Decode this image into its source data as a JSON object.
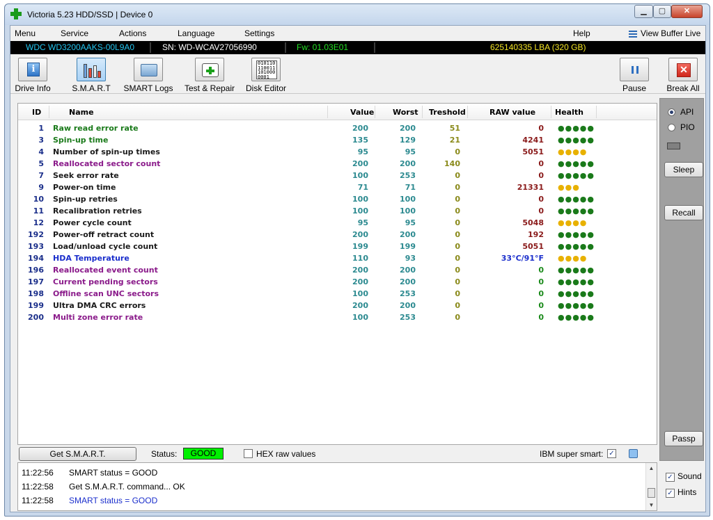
{
  "window": {
    "title": "Victoria 5.23 HDD/SSD | Device 0"
  },
  "menu": {
    "items": [
      "Menu",
      "Service",
      "Actions",
      "Language",
      "Settings",
      "Help"
    ],
    "view_buffer": "View Buffer Live"
  },
  "device": {
    "model": "WDC WD3200AAKS-00L9A0",
    "serial": "SN: WD-WCAV27056990",
    "firmware": "Fw: 01.03E01",
    "capacity": "625140335 LBA (320 GB)"
  },
  "toolbar": {
    "drive_info": "Drive Info",
    "smart": "S.M.A.R.T",
    "smart_logs": "SMART Logs",
    "test_repair": "Test & Repair",
    "disk_editor": "Disk Editor",
    "pause": "Pause",
    "break_all": "Break All",
    "hex_icon_text": "010110\n110011\n101000\n0001"
  },
  "table": {
    "headers": {
      "id": "ID",
      "name": "Name",
      "value": "Value",
      "worst": "Worst",
      "treshold": "Treshold",
      "raw": "RAW value",
      "health": "Health"
    },
    "rows": [
      {
        "id": "1",
        "name": "Raw read error rate",
        "value": "200",
        "worst": "200",
        "tresh": "51",
        "raw": "0",
        "health": "●●●●●",
        "name_color": "#1a7a1a",
        "health_color": "#1a7a1a"
      },
      {
        "id": "3",
        "name": "Spin-up time",
        "value": "135",
        "worst": "129",
        "tresh": "21",
        "raw": "4241",
        "health": "●●●●●",
        "name_color": "#1a7a1a",
        "health_color": "#1a7a1a"
      },
      {
        "id": "4",
        "name": "Number of spin-up times",
        "value": "95",
        "worst": "95",
        "tresh": "0",
        "raw": "5051",
        "health": "●●●●",
        "name_color": "#1a1a1a",
        "health_color": "#e8b100"
      },
      {
        "id": "5",
        "name": "Reallocated sector count",
        "value": "200",
        "worst": "200",
        "tresh": "140",
        "raw": "0",
        "health": "●●●●●",
        "name_color": "#8a1a8a",
        "health_color": "#1a7a1a"
      },
      {
        "id": "7",
        "name": "Seek error rate",
        "value": "100",
        "worst": "253",
        "tresh": "0",
        "raw": "0",
        "health": "●●●●●",
        "name_color": "#1a1a1a",
        "health_color": "#1a7a1a"
      },
      {
        "id": "9",
        "name": "Power-on time",
        "value": "71",
        "worst": "71",
        "tresh": "0",
        "raw": "21331",
        "health": "●●●",
        "name_color": "#1a1a1a",
        "health_color": "#e8b100"
      },
      {
        "id": "10",
        "name": "Spin-up retries",
        "value": "100",
        "worst": "100",
        "tresh": "0",
        "raw": "0",
        "health": "●●●●●",
        "name_color": "#1a1a1a",
        "health_color": "#1a7a1a"
      },
      {
        "id": "11",
        "name": "Recalibration retries",
        "value": "100",
        "worst": "100",
        "tresh": "0",
        "raw": "0",
        "health": "●●●●●",
        "name_color": "#1a1a1a",
        "health_color": "#1a7a1a"
      },
      {
        "id": "12",
        "name": "Power cycle count",
        "value": "95",
        "worst": "95",
        "tresh": "0",
        "raw": "5048",
        "health": "●●●●",
        "name_color": "#1a1a1a",
        "health_color": "#e8b100"
      },
      {
        "id": "192",
        "name": "Power-off retract count",
        "value": "200",
        "worst": "200",
        "tresh": "0",
        "raw": "192",
        "health": "●●●●●",
        "name_color": "#1a1a1a",
        "health_color": "#1a7a1a"
      },
      {
        "id": "193",
        "name": "Load/unload cycle count",
        "value": "199",
        "worst": "199",
        "tresh": "0",
        "raw": "5051",
        "health": "●●●●●",
        "name_color": "#1a1a1a",
        "health_color": "#1a7a1a"
      },
      {
        "id": "194",
        "name": "HDA Temperature",
        "value": "110",
        "worst": "93",
        "tresh": "0",
        "raw": "33°C/91°F",
        "health": "●●●●",
        "name_color": "#1a2ecc",
        "health_color": "#e8b100",
        "raw_color": "#1a2ecc"
      },
      {
        "id": "196",
        "name": "Reallocated event count",
        "value": "200",
        "worst": "200",
        "tresh": "0",
        "raw": "0",
        "health": "●●●●●",
        "name_color": "#8a1a8a",
        "health_color": "#1a7a1a",
        "raw_color": "#1a8a1a"
      },
      {
        "id": "197",
        "name": "Current pending sectors",
        "value": "200",
        "worst": "200",
        "tresh": "0",
        "raw": "0",
        "health": "●●●●●",
        "name_color": "#8a1a8a",
        "health_color": "#1a7a1a",
        "raw_color": "#1a8a1a"
      },
      {
        "id": "198",
        "name": "Offline scan UNC sectors",
        "value": "100",
        "worst": "253",
        "tresh": "0",
        "raw": "0",
        "health": "●●●●●",
        "name_color": "#8a1a8a",
        "health_color": "#1a7a1a",
        "raw_color": "#1a8a1a"
      },
      {
        "id": "199",
        "name": "Ultra DMA CRC errors",
        "value": "200",
        "worst": "200",
        "tresh": "0",
        "raw": "0",
        "health": "●●●●●",
        "name_color": "#1a1a1a",
        "health_color": "#1a7a1a",
        "raw_color": "#1a8a1a"
      },
      {
        "id": "200",
        "name": "Multi zone error rate",
        "value": "100",
        "worst": "253",
        "tresh": "0",
        "raw": "0",
        "health": "●●●●●",
        "name_color": "#8a1a8a",
        "health_color": "#1a7a1a",
        "raw_color": "#1a8a1a"
      }
    ]
  },
  "bottom": {
    "get_smart": "Get S.M.A.R.T.",
    "status_label": "Status:",
    "status_value": "GOOD",
    "hex_raw": "HEX raw values",
    "ibm": "IBM super smart:"
  },
  "log": [
    {
      "time": "11:22:56",
      "text": "SMART status = GOOD",
      "color": "#000000"
    },
    {
      "time": "11:22:58",
      "text": "Get S.M.A.R.T. command... OK",
      "color": "#000000"
    },
    {
      "time": "11:22:58",
      "text": "SMART status = GOOD",
      "color": "#1a2ecc"
    }
  ],
  "side": {
    "api": "API",
    "pio": "PIO",
    "sleep": "Sleep",
    "recall": "Recall",
    "passp": "Passp",
    "sound": "Sound",
    "hints": "Hints"
  },
  "colors": {
    "devbar_model": "#23c5f0",
    "devbar_serial": "#ffffff",
    "devbar_fw": "#23e023",
    "devbar_capacity": "#f5e623",
    "status_good": "#00f000"
  },
  "icons": {
    "drive_info": "info-icon",
    "smart": "bar-chart-icon",
    "smart_logs": "folder-icon",
    "test_repair": "first-aid-icon",
    "disk_editor": "hex-icon",
    "pause": "pause-icon",
    "break_all": "stop-icon"
  }
}
